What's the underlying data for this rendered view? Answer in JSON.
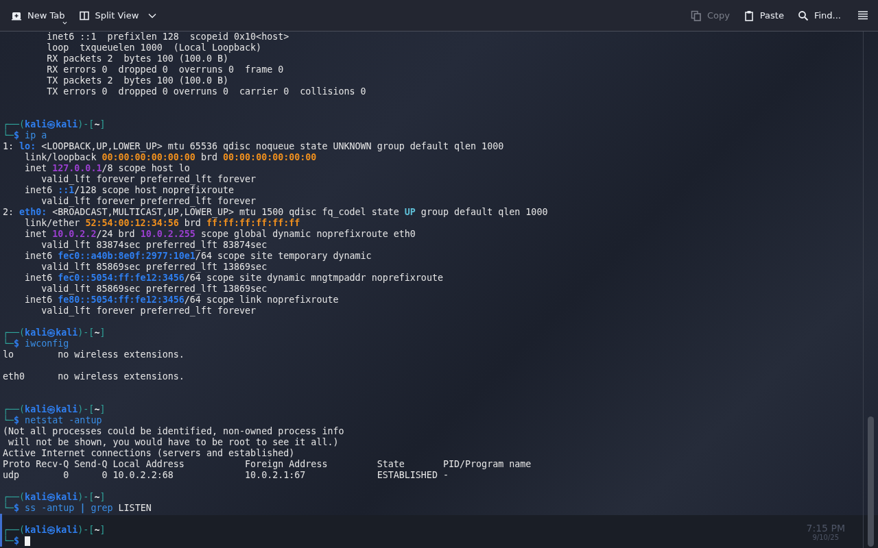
{
  "toolbar": {
    "left": [
      {
        "label": "New Tab",
        "kind": "new-tab",
        "disabled": false,
        "dropdown": true
      },
      {
        "label": "Split View",
        "kind": "split",
        "disabled": false,
        "dropdown": true
      }
    ],
    "right": [
      {
        "label": "Copy",
        "kind": "copy",
        "disabled": true
      },
      {
        "label": "Paste",
        "kind": "paste",
        "disabled": false
      },
      {
        "label": "Find...",
        "kind": "search",
        "disabled": false
      }
    ]
  },
  "terminal": {
    "lines": [
      {
        "kind": "text",
        "segments": [
          {
            "text": "        inet6 ::1  prefixlen 128  scopeid 0x10<host>",
            "kind": "plain"
          }
        ]
      },
      {
        "kind": "text",
        "segments": [
          {
            "text": "        loop  txqueuelen 1000  (Local Loopback)",
            "kind": "plain"
          }
        ]
      },
      {
        "kind": "text",
        "segments": [
          {
            "text": "        RX packets 2  bytes 100 (100.0 B)",
            "kind": "plain"
          }
        ]
      },
      {
        "kind": "text",
        "segments": [
          {
            "text": "        RX errors 0  dropped 0  overruns 0  frame 0",
            "kind": "plain"
          }
        ]
      },
      {
        "kind": "text",
        "segments": [
          {
            "text": "        TX packets 2  bytes 100 (100.0 B)",
            "kind": "plain"
          }
        ]
      },
      {
        "kind": "text",
        "segments": [
          {
            "text": "        TX errors 0  dropped 0 overruns 0  carrier 0  collisions 0",
            "kind": "plain"
          }
        ]
      },
      {
        "kind": "blank"
      },
      {
        "kind": "blank"
      },
      {
        "kind": "text",
        "segments": [
          {
            "text": "┌──(",
            "kind": "frame"
          },
          {
            "text": "kali㉿kali",
            "kind": "user"
          },
          {
            "text": ")-[",
            "kind": "frame"
          },
          {
            "text": "~",
            "kind": "dir"
          },
          {
            "text": "]",
            "kind": "frame"
          }
        ]
      },
      {
        "kind": "text",
        "segments": [
          {
            "text": "└─",
            "kind": "frame"
          },
          {
            "text": "$",
            "kind": "user"
          },
          {
            "text": " ip a",
            "kind": "cmd"
          }
        ]
      },
      {
        "kind": "text",
        "segments": [
          {
            "text": "1: ",
            "kind": "plain"
          },
          {
            "text": "lo:",
            "kind": "iface"
          },
          {
            "text": " <LOOPBACK,UP,LOWER_UP> mtu 65536 qdisc noqueue state UNKNOWN group default qlen 1000",
            "kind": "plain"
          }
        ]
      },
      {
        "kind": "text",
        "segments": [
          {
            "text": "    link/loopback ",
            "kind": "plain"
          },
          {
            "text": "00:00:00:00:00:00",
            "kind": "mac"
          },
          {
            "text": " brd ",
            "kind": "plain"
          },
          {
            "text": "00:00:00:00:00:00",
            "kind": "mac"
          }
        ]
      },
      {
        "kind": "text",
        "segments": [
          {
            "text": "    inet ",
            "kind": "plain"
          },
          {
            "text": "127.0.0.1",
            "kind": "ipv4"
          },
          {
            "text": "/8 scope host lo",
            "kind": "plain"
          }
        ]
      },
      {
        "kind": "text",
        "segments": [
          {
            "text": "       valid_lft forever preferred_lft forever",
            "kind": "plain"
          }
        ]
      },
      {
        "kind": "text",
        "segments": [
          {
            "text": "    inet6 ",
            "kind": "plain"
          },
          {
            "text": "::1",
            "kind": "ipv6"
          },
          {
            "text": "/128 scope host noprefixroute",
            "kind": "plain"
          }
        ]
      },
      {
        "kind": "text",
        "segments": [
          {
            "text": "       valid_lft forever preferred_lft forever",
            "kind": "plain"
          }
        ]
      },
      {
        "kind": "text",
        "segments": [
          {
            "text": "2: ",
            "kind": "plain"
          },
          {
            "text": "eth0:",
            "kind": "iface"
          },
          {
            "text": " <BROADCAST,MULTICAST,UP,LOWER_UP> mtu 1500 qdisc fq_codel state ",
            "kind": "plain"
          },
          {
            "text": "UP",
            "kind": "up"
          },
          {
            "text": " group default qlen 1000",
            "kind": "plain"
          }
        ]
      },
      {
        "kind": "text",
        "segments": [
          {
            "text": "    link/ether ",
            "kind": "plain"
          },
          {
            "text": "52:54:00:12:34:56",
            "kind": "mac"
          },
          {
            "text": " brd ",
            "kind": "plain"
          },
          {
            "text": "ff:ff:ff:ff:ff:ff",
            "kind": "mac"
          }
        ]
      },
      {
        "kind": "text",
        "segments": [
          {
            "text": "    inet ",
            "kind": "plain"
          },
          {
            "text": "10.0.2.2",
            "kind": "ipv4"
          },
          {
            "text": "/24 brd ",
            "kind": "plain"
          },
          {
            "text": "10.0.2.255",
            "kind": "ipv4"
          },
          {
            "text": " scope global dynamic noprefixroute eth0",
            "kind": "plain"
          }
        ]
      },
      {
        "kind": "text",
        "segments": [
          {
            "text": "       valid_lft 83874sec preferred_lft 83874sec",
            "kind": "plain"
          }
        ]
      },
      {
        "kind": "text",
        "segments": [
          {
            "text": "    inet6 ",
            "kind": "plain"
          },
          {
            "text": "fec0::a40b:8e0f:2977:10e1",
            "kind": "ipv6"
          },
          {
            "text": "/64 scope site temporary dynamic",
            "kind": "plain"
          }
        ]
      },
      {
        "kind": "text",
        "segments": [
          {
            "text": "       valid_lft 85869sec preferred_lft 13869sec",
            "kind": "plain"
          }
        ]
      },
      {
        "kind": "text",
        "segments": [
          {
            "text": "    inet6 ",
            "kind": "plain"
          },
          {
            "text": "fec0::5054:ff:fe12:3456",
            "kind": "ipv6"
          },
          {
            "text": "/64 scope site dynamic mngtmpaddr noprefixroute",
            "kind": "plain"
          }
        ]
      },
      {
        "kind": "text",
        "segments": [
          {
            "text": "       valid_lft 85869sec preferred_lft 13869sec",
            "kind": "plain"
          }
        ]
      },
      {
        "kind": "text",
        "segments": [
          {
            "text": "    inet6 ",
            "kind": "plain"
          },
          {
            "text": "fe80::5054:ff:fe12:3456",
            "kind": "ipv6"
          },
          {
            "text": "/64 scope link noprefixroute",
            "kind": "plain"
          }
        ]
      },
      {
        "kind": "text",
        "segments": [
          {
            "text": "       valid_lft forever preferred_lft forever",
            "kind": "plain"
          }
        ]
      },
      {
        "kind": "blank"
      },
      {
        "kind": "text",
        "segments": [
          {
            "text": "┌──(",
            "kind": "frame"
          },
          {
            "text": "kali㉿kali",
            "kind": "user"
          },
          {
            "text": ")-[",
            "kind": "frame"
          },
          {
            "text": "~",
            "kind": "dir"
          },
          {
            "text": "]",
            "kind": "frame"
          }
        ]
      },
      {
        "kind": "text",
        "segments": [
          {
            "text": "└─",
            "kind": "frame"
          },
          {
            "text": "$",
            "kind": "user"
          },
          {
            "text": " iwconfig",
            "kind": "cmd"
          }
        ]
      },
      {
        "kind": "text",
        "segments": [
          {
            "text": "lo        no wireless extensions.",
            "kind": "plain"
          }
        ]
      },
      {
        "kind": "blank"
      },
      {
        "kind": "text",
        "segments": [
          {
            "text": "eth0      no wireless extensions.",
            "kind": "plain"
          }
        ]
      },
      {
        "kind": "blank"
      },
      {
        "kind": "blank"
      },
      {
        "kind": "text",
        "segments": [
          {
            "text": "┌──(",
            "kind": "frame"
          },
          {
            "text": "kali㉿kali",
            "kind": "user"
          },
          {
            "text": ")-[",
            "kind": "frame"
          },
          {
            "text": "~",
            "kind": "dir"
          },
          {
            "text": "]",
            "kind": "frame"
          }
        ]
      },
      {
        "kind": "text",
        "segments": [
          {
            "text": "└─",
            "kind": "frame"
          },
          {
            "text": "$",
            "kind": "user"
          },
          {
            "text": " netstat -antup",
            "kind": "cmd"
          }
        ]
      },
      {
        "kind": "text",
        "segments": [
          {
            "text": "(Not all processes could be identified, non-owned process info",
            "kind": "plain"
          }
        ]
      },
      {
        "kind": "text",
        "segments": [
          {
            "text": " will not be shown, you would have to be root to see it all.)",
            "kind": "plain"
          }
        ]
      },
      {
        "kind": "text",
        "segments": [
          {
            "text": "Active Internet connections (servers and established)",
            "kind": "plain"
          }
        ]
      },
      {
        "kind": "text",
        "segments": [
          {
            "text": "Proto Recv-Q Send-Q Local Address           Foreign Address         State       PID/Program name",
            "kind": "plain"
          }
        ]
      },
      {
        "kind": "text",
        "segments": [
          {
            "text": "udp        0      0 10.0.2.2:68             10.0.2.1:67             ESTABLISHED -",
            "kind": "plain"
          }
        ]
      },
      {
        "kind": "blank"
      },
      {
        "kind": "text",
        "segments": [
          {
            "text": "┌──(",
            "kind": "frame"
          },
          {
            "text": "kali㉿kali",
            "kind": "user"
          },
          {
            "text": ")-[",
            "kind": "frame"
          },
          {
            "text": "~",
            "kind": "dir"
          },
          {
            "text": "]",
            "kind": "frame"
          }
        ]
      },
      {
        "kind": "text",
        "segments": [
          {
            "text": "└─",
            "kind": "frame"
          },
          {
            "text": "$",
            "kind": "user"
          },
          {
            "text": " ss -antup ",
            "kind": "cmd"
          },
          {
            "text": "|",
            "kind": "pipe"
          },
          {
            "text": " grep ",
            "kind": "cmd"
          },
          {
            "text": "LISTEN",
            "kind": "plain"
          }
        ]
      },
      {
        "kind": "blank",
        "current": true
      },
      {
        "kind": "text",
        "current": true,
        "segments": [
          {
            "text": "┌──(",
            "kind": "frame"
          },
          {
            "text": "kali㉿kali",
            "kind": "user"
          },
          {
            "text": ")-[",
            "kind": "frame"
          },
          {
            "text": "~",
            "kind": "dir"
          },
          {
            "text": "]",
            "kind": "frame"
          }
        ]
      },
      {
        "kind": "text",
        "current": true,
        "cursor": true,
        "segments": [
          {
            "text": "└─",
            "kind": "frame"
          },
          {
            "text": "$",
            "kind": "user"
          }
        ]
      }
    ]
  },
  "taskbar": {
    "time": "7:15 PM",
    "date": "9/10/25"
  }
}
